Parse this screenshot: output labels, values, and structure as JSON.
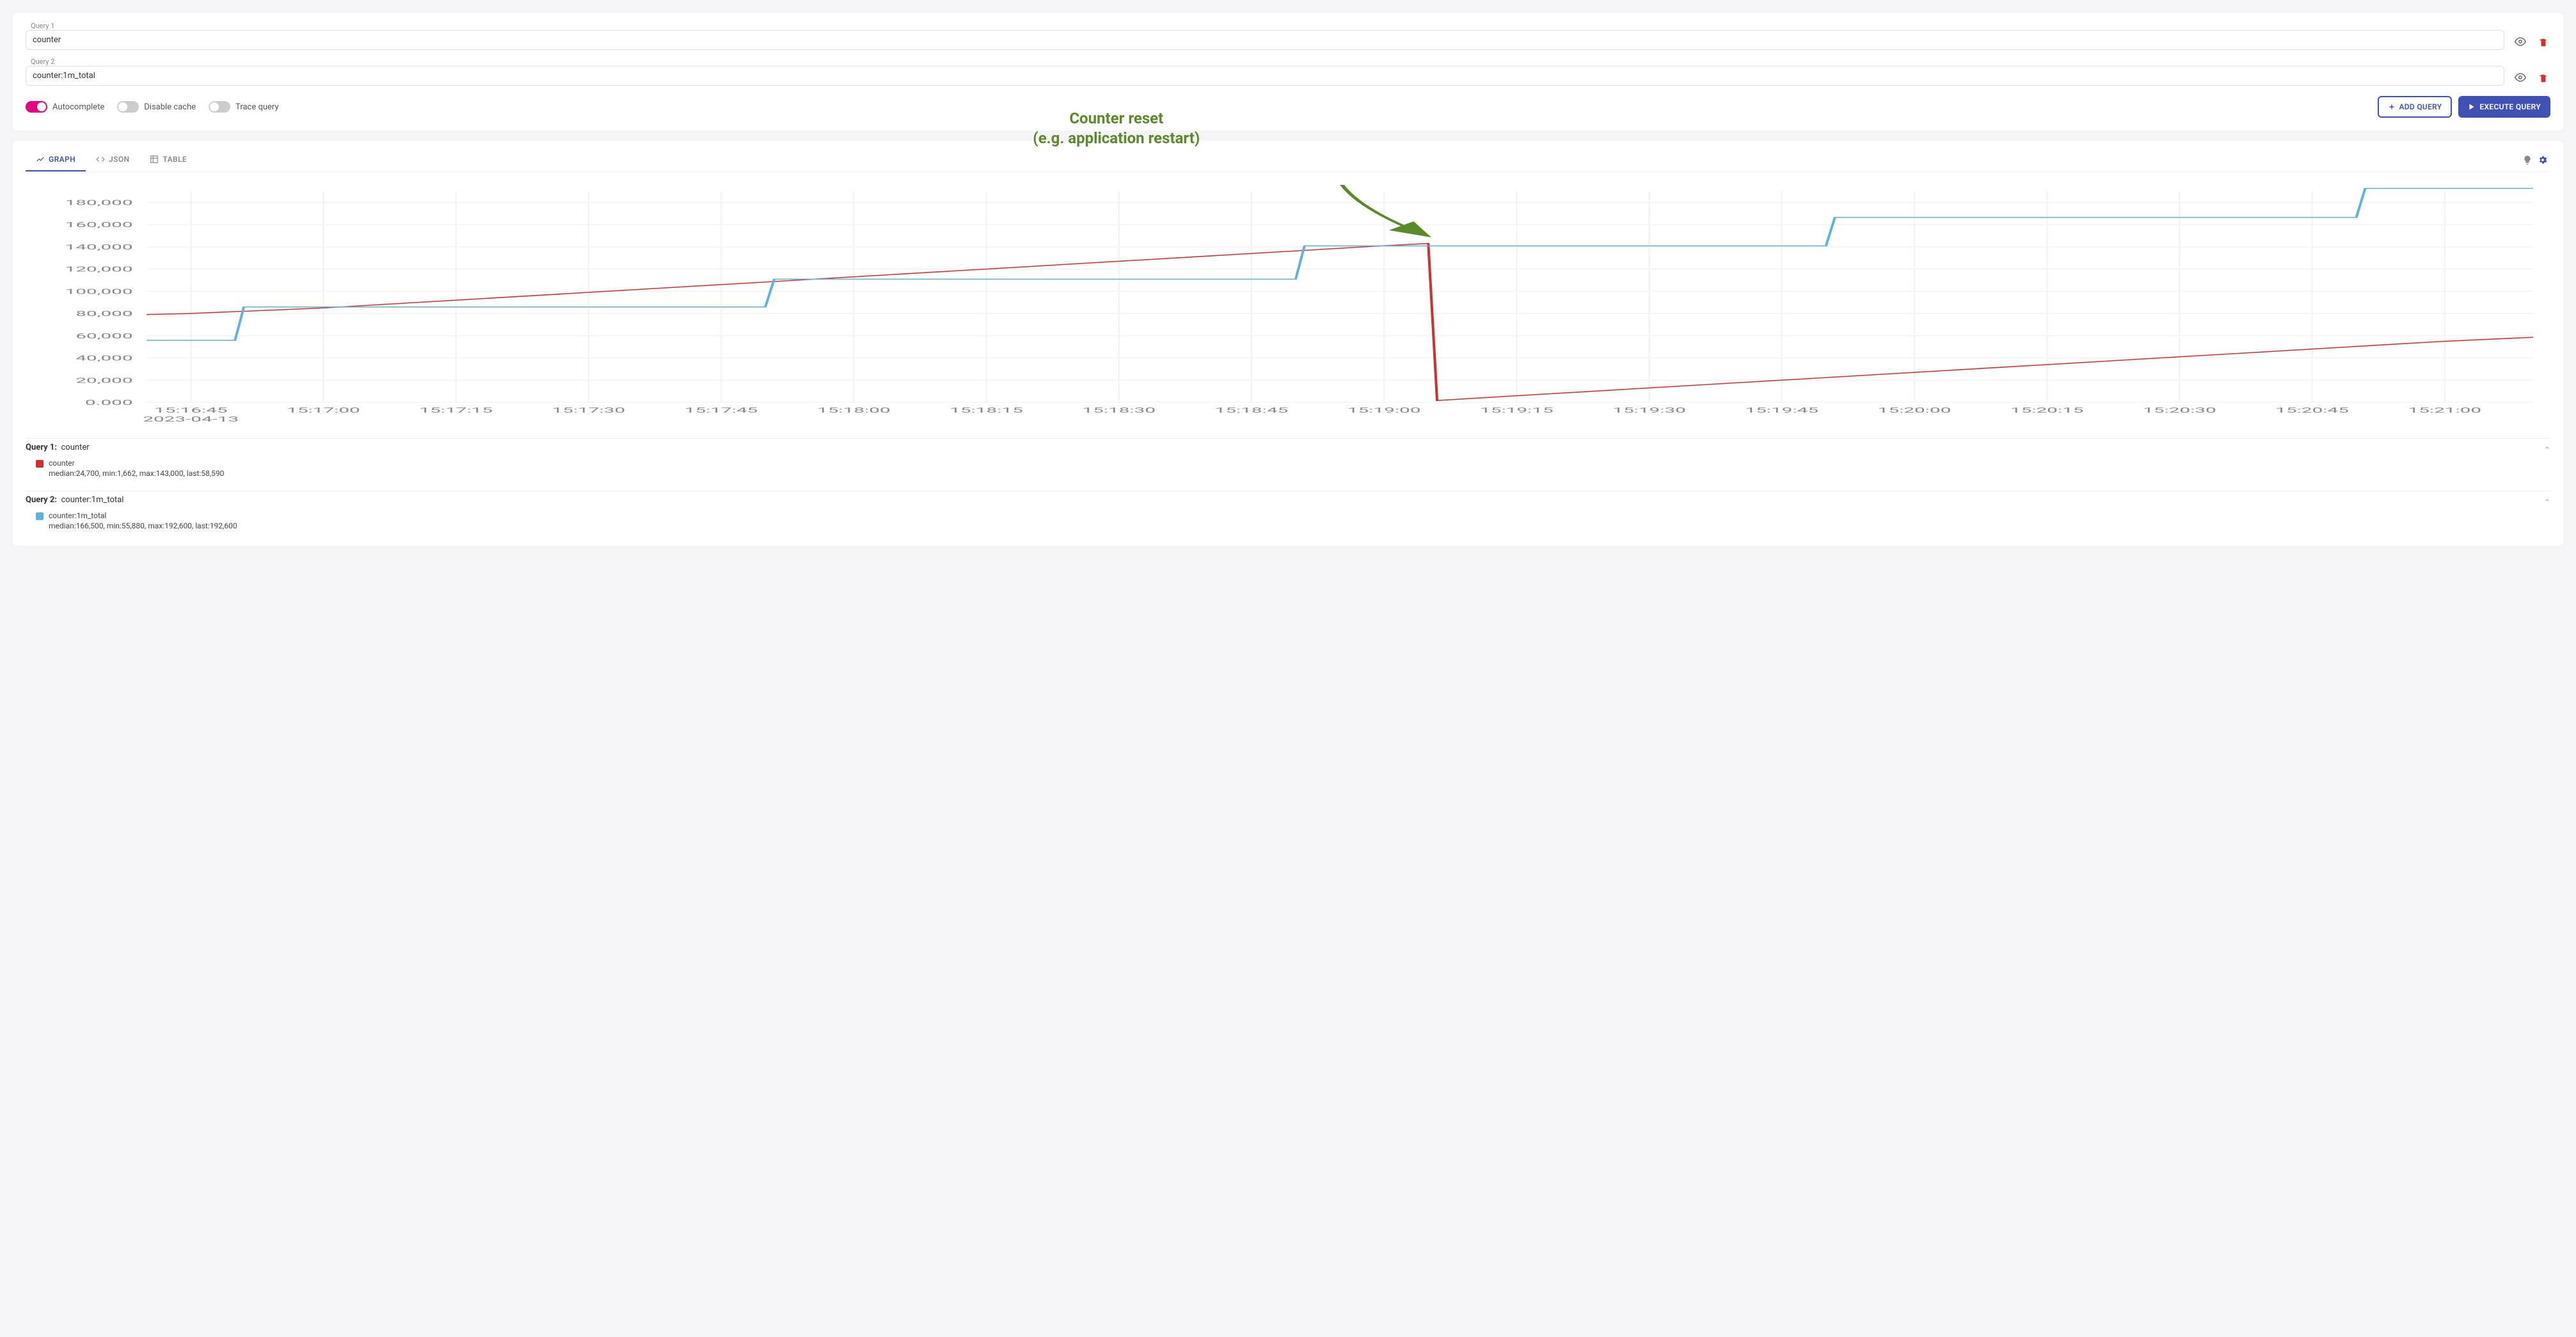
{
  "queries": [
    {
      "label": "Query 1",
      "value": "counter"
    },
    {
      "label": "Query 2",
      "value": "counter:1m_total"
    }
  ],
  "toggles": {
    "autocomplete": {
      "label": "Autocomplete",
      "on": true
    },
    "disable_cache": {
      "label": "Disable cache",
      "on": false
    },
    "trace_query": {
      "label": "Trace query",
      "on": false
    }
  },
  "buttons": {
    "add_query": "ADD QUERY",
    "execute_query": "EXECUTE QUERY"
  },
  "tabs": {
    "graph": "GRAPH",
    "json": "JSON",
    "table": "TABLE"
  },
  "annotation": {
    "line1": "Counter reset",
    "line2": "(e.g. application restart)"
  },
  "legend": [
    {
      "title_prefix": "Query 1:",
      "title_query": "counter",
      "series_name": "counter",
      "color": "#d32f2f",
      "stats": "median:24,700, min:1,662, max:143,000, last:58,590"
    },
    {
      "title_prefix": "Query 2:",
      "title_query": "counter:1m_total",
      "series_name": "counter:1m_total",
      "color": "#5bb4e0",
      "stats": "median:166,500, min:55,880, max:192,600, last:192,600"
    }
  ],
  "chart_data": {
    "type": "line",
    "title": "",
    "xlabel": "",
    "ylabel": "",
    "ylim": [
      0,
      190000
    ],
    "x_date": "2023-04-13",
    "x_ticks": [
      "15:16:45",
      "15:17:00",
      "15:17:15",
      "15:17:30",
      "15:17:45",
      "15:18:00",
      "15:18:15",
      "15:18:30",
      "15:18:45",
      "15:19:00",
      "15:19:15",
      "15:19:30",
      "15:19:45",
      "15:20:00",
      "15:20:15",
      "15:20:30",
      "15:20:45",
      "15:21:00"
    ],
    "y_ticks": [
      "0.000",
      "20,000",
      "40,000",
      "60,000",
      "80,000",
      "100,000",
      "120,000",
      "140,000",
      "160,000",
      "180,000"
    ],
    "series": [
      {
        "name": "counter",
        "color": "#d32f2f",
        "x": [
          "15:16:40",
          "15:16:45",
          "15:17:00",
          "15:17:15",
          "15:17:30",
          "15:17:45",
          "15:18:00",
          "15:18:15",
          "15:18:30",
          "15:18:45",
          "15:19:00",
          "15:19:05",
          "15:19:06",
          "15:19:15",
          "15:19:30",
          "15:19:45",
          "15:20:00",
          "15:20:15",
          "15:20:30",
          "15:20:45",
          "15:21:00",
          "15:21:10"
        ],
        "y": [
          79000,
          80000,
          85000,
          92000,
          99000,
          106000,
          113000,
          120000,
          127000,
          134000,
          141000,
          143000,
          1662,
          6000,
          13000,
          20000,
          27000,
          34000,
          41000,
          48000,
          55000,
          58590
        ]
      },
      {
        "name": "counter:1m_total",
        "color": "#5bb4e0",
        "x": [
          "15:16:40",
          "15:16:50",
          "15:16:51",
          "15:17:50",
          "15:17:51",
          "15:18:50",
          "15:18:51",
          "15:19:50",
          "15:19:51",
          "15:20:50",
          "15:20:51",
          "15:21:10"
        ],
        "y": [
          55880,
          55880,
          85880,
          85880,
          110880,
          110880,
          140880,
          140880,
          166500,
          166500,
          192600,
          192600
        ]
      }
    ]
  }
}
